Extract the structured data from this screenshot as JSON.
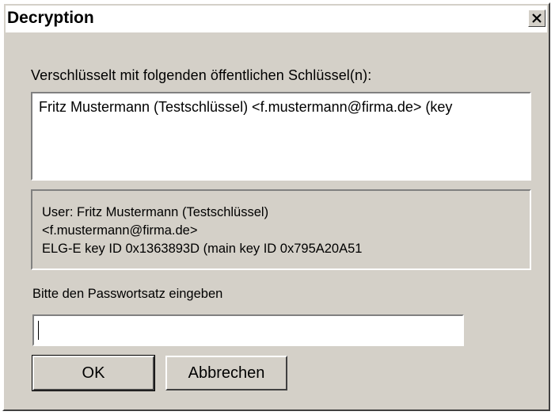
{
  "window": {
    "title": "Decryption",
    "close_icon": "close-x-icon"
  },
  "recipients": {
    "label": "Verschlüsselt mit folgenden öffentlichen Schlüssel(n):",
    "items": [
      "Fritz Mustermann (Testschlüssel) <f.mustermann@firma.de> (key"
    ]
  },
  "user_info": {
    "line1": "User: Fritz Mustermann (Testschlüssel)",
    "line2": "<f.mustermann@firma.de>",
    "line3": "ELG-E key ID 0x1363893D (main key ID 0x795A20A51"
  },
  "passphrase": {
    "label": "Bitte den Passwortsatz eingeben",
    "value": ""
  },
  "buttons": {
    "ok": "OK",
    "cancel": "Abbrechen"
  }
}
